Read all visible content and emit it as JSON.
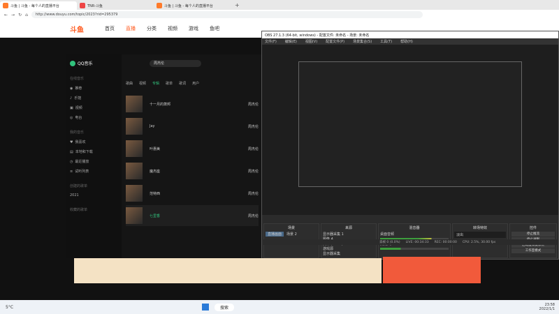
{
  "browser": {
    "tabs": [
      {
        "label": "斗鱼 | 斗鱼 - 每个人的直播平台"
      },
      {
        "label": "TNR-斗鱼"
      },
      {
        "label": "斗鱼 | 斗鱼 - 每个人的直播平台"
      }
    ],
    "url": "http://www.douyu.com/topic/2023?rid=295379"
  },
  "site": {
    "logo": "斗鱼",
    "nav": [
      "首页",
      "直播",
      "分类",
      "视频",
      "游戏",
      "鱼吧"
    ]
  },
  "qq_music": {
    "title": "QQ音乐",
    "search": "周杰伦",
    "categories": [
      "歌曲",
      "视频",
      "专辑",
      "歌单",
      "歌词",
      "用户"
    ],
    "side": {
      "online_header": "在线音乐",
      "online": [
        "推荐",
        "乐馆",
        "视频",
        "电台"
      ],
      "mine_header": "我的音乐",
      "mine": [
        "我喜欢",
        "本地和下载",
        "最近播放",
        "试听列表"
      ],
      "created_header": "创建的歌单",
      "year": "2021",
      "collected_header": "收藏的歌单"
    },
    "rows": [
      {
        "title": "十一月的萧邦",
        "artist": "周杰伦"
      },
      {
        "title": "Jay",
        "artist": "周杰伦"
      },
      {
        "title": "叶惠美",
        "artist": "周杰伦"
      },
      {
        "title": "魔杰座",
        "artist": "周杰伦"
      },
      {
        "title": "范特西",
        "artist": "周杰伦"
      },
      {
        "title": "七里香",
        "artist": "周杰伦"
      }
    ]
  },
  "obs": {
    "title": "OBS 27.1.3 (64-bit, windows) - 配置文件: 未命名 - 场景: 未命名",
    "menu": [
      "文件(F)",
      "编辑(E)",
      "视图(V)",
      "配置文件(P)",
      "场景集合(S)",
      "工具(T)",
      "帮助(H)"
    ],
    "docks": {
      "scenes_header": "场景",
      "scenes": [
        "直播画面",
        "场景 2"
      ],
      "sources_header": "来源",
      "sources": [
        "显示器采集 1",
        "图像 4",
        "文本 (GDI+)",
        "游戏源",
        "显示器采集"
      ],
      "mixer_header": "混音器",
      "mixer": [
        "桌面音频",
        "麦克风/Aux"
      ],
      "transitions_header": "转场特效",
      "transition": "淡出",
      "controls_header": "控件",
      "controls": [
        "停止推流",
        "停止录制",
        "启动虚拟摄像机",
        "工作室模式",
        "设置",
        "退出"
      ]
    },
    "status": [
      "丢帧 0 (0.0%)",
      "LIVE: 00:34:33",
      "REC: 00:00:00",
      "CPU: 2.5%, 30.00 fps"
    ]
  },
  "taskbar": {
    "weather": "5°C",
    "search": "搜索",
    "time": "23:58",
    "date": "2022/1/1"
  },
  "colors": {
    "accent": "#ff5d23",
    "qqgreen": "#31c27c"
  }
}
